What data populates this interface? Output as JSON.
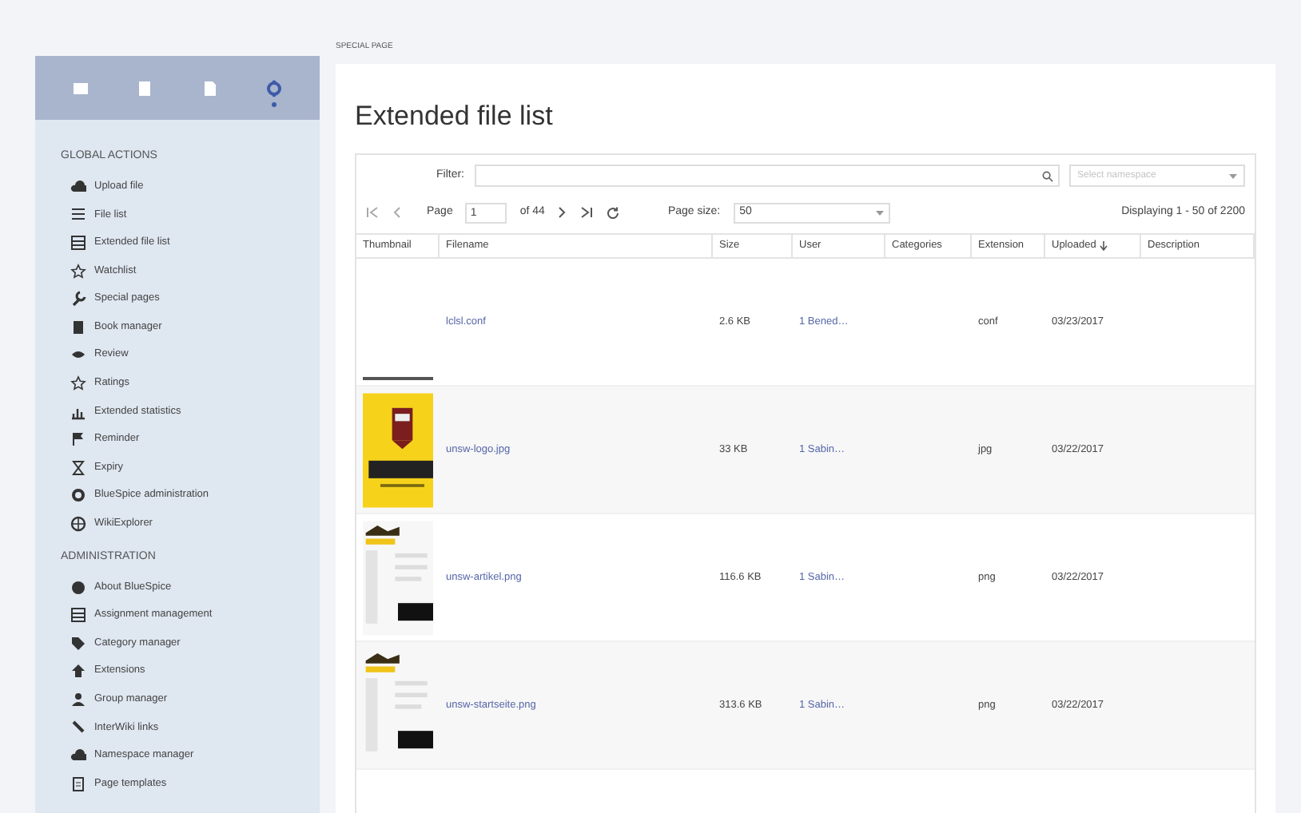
{
  "sidebar": {
    "tabs": [
      {
        "kind": "menu",
        "selected": false
      },
      {
        "kind": "page",
        "selected": false
      },
      {
        "kind": "bookmark",
        "selected": false
      },
      {
        "kind": "gear",
        "selected": true
      }
    ],
    "sections": [
      {
        "title": "GLOBAL ACTIONS",
        "items": [
          {
            "label": "Upload file",
            "kind": "cloud"
          },
          {
            "label": "File list",
            "kind": "list"
          },
          {
            "label": "Extended file list",
            "kind": "table"
          },
          {
            "label": "Watchlist",
            "kind": "star"
          },
          {
            "label": "Special pages",
            "kind": "wrench"
          },
          {
            "label": "Book manager",
            "kind": "book"
          },
          {
            "label": "Review",
            "kind": "eye"
          },
          {
            "label": "Ratings",
            "kind": "star"
          },
          {
            "label": "Extended statistics",
            "kind": "chart"
          },
          {
            "label": "Reminder",
            "kind": "flag"
          },
          {
            "label": "Expiry",
            "kind": "hourglass"
          },
          {
            "label": "BlueSpice administration",
            "kind": "gear"
          },
          {
            "label": "WikiExplorer",
            "kind": "globe"
          }
        ]
      },
      {
        "title": "ADMINISTRATION",
        "items": [
          {
            "label": "About BlueSpice",
            "kind": "info"
          },
          {
            "label": "Assignment management",
            "kind": "table"
          },
          {
            "label": "Category manager",
            "kind": "tag"
          },
          {
            "label": "Extensions",
            "kind": "puzzle"
          },
          {
            "label": "Group manager",
            "kind": "users"
          },
          {
            "label": "InterWiki links",
            "kind": "link"
          },
          {
            "label": "Namespace manager",
            "kind": "cloud"
          },
          {
            "label": "Page templates",
            "kind": "page"
          }
        ]
      }
    ]
  },
  "breadcrumb": "SPECIAL PAGE",
  "title": "Extended file list",
  "filter": {
    "label": "Filter:",
    "namespace_placeholder": "Select namespace"
  },
  "pager": {
    "page_label": "Page",
    "page": "1",
    "of": "of 44",
    "page_size_label": "Page size:",
    "page_size": "50",
    "display": "Displaying 1 - 50 of 2200"
  },
  "table": {
    "columns": [
      {
        "label": "Thumbnail",
        "sorted": false
      },
      {
        "label": "Filename",
        "sorted": false
      },
      {
        "label": "Size",
        "sorted": false
      },
      {
        "label": "User",
        "sorted": false
      },
      {
        "label": "Categories",
        "sorted": false
      },
      {
        "label": "Extension",
        "sorted": false
      },
      {
        "label": "Uploaded",
        "sorted": true
      },
      {
        "label": "Description",
        "sorted": false
      }
    ],
    "rows": [
      {
        "thumbnail": {
          "kind": "blank"
        },
        "filename": "lclsl.conf",
        "size": "2.6 KB",
        "user": "1 Bened…",
        "extension": "conf",
        "uploaded": "03/23/2017"
      },
      {
        "filename": "unsw-logo.jpg",
        "size": "33 KB",
        "user": "1 Sabin…",
        "extension": "jpg",
        "uploaded": "03/22/2017"
      },
      {
        "filename": "unsw-artikel.png",
        "size": "116.6 KB",
        "user": "1 Sabin…",
        "extension": "png",
        "uploaded": "03/22/2017"
      },
      {
        "filename": "unsw-startseite.png",
        "size": "313.6 KB",
        "user": "1 Sabin…",
        "extension": "png",
        "uploaded": "03/22/2017"
      }
    ]
  }
}
